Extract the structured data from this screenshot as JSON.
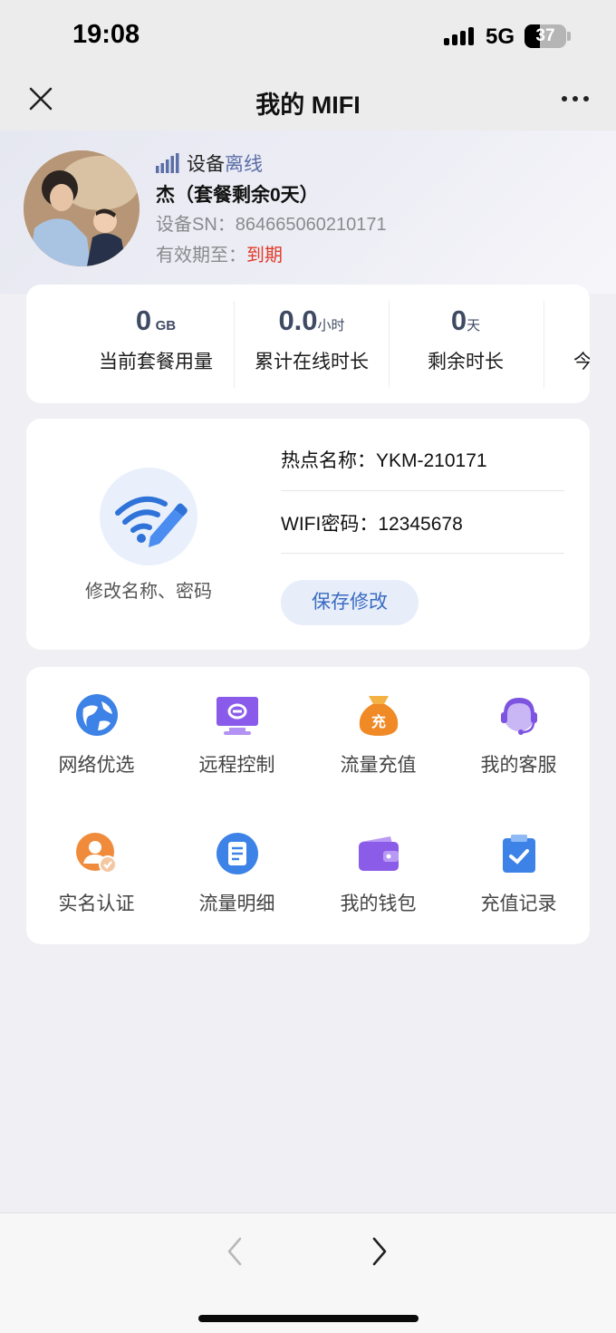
{
  "status_bar": {
    "time": "19:08",
    "network": "5G",
    "battery": "37"
  },
  "nav": {
    "title": "我的 MIFI"
  },
  "profile": {
    "device_prefix": "设备",
    "device_status": "离线",
    "owner": "杰（套餐剩余0天）",
    "sn": "设备SN：864665060210171",
    "expiry_prefix": "有效期至：",
    "expiry_value": "到期"
  },
  "stats": [
    {
      "value": "0",
      "unit": "GB",
      "label": "当前套餐用量"
    },
    {
      "value": "0.0",
      "unit": "小时",
      "label": "累计在线时长"
    },
    {
      "value": "0",
      "unit": "天",
      "label": "剩余时长"
    },
    {
      "label": "今"
    }
  ],
  "wifi": {
    "caption": "修改名称、密码",
    "ssid_label": "热点名称：YKM-210171",
    "password_label": "WIFI密码：12345678",
    "save_label": "保存修改"
  },
  "menu": [
    {
      "label": "网络优选",
      "icon": "globe-icon"
    },
    {
      "label": "远程控制",
      "icon": "remote-monitor-icon"
    },
    {
      "label": "流量充值",
      "icon": "recharge-bag-icon"
    },
    {
      "label": "我的客服",
      "icon": "customer-service-icon"
    },
    {
      "label": "实名认证",
      "icon": "user-verify-icon"
    },
    {
      "label": "流量明细",
      "icon": "document-list-icon"
    },
    {
      "label": "我的钱包",
      "icon": "wallet-icon"
    },
    {
      "label": "充值记录",
      "icon": "clipboard-check-icon"
    }
  ],
  "colors": {
    "accent": "#3a6bc2",
    "expired": "#e23b2a",
    "stat_text": "#3f4a63"
  }
}
